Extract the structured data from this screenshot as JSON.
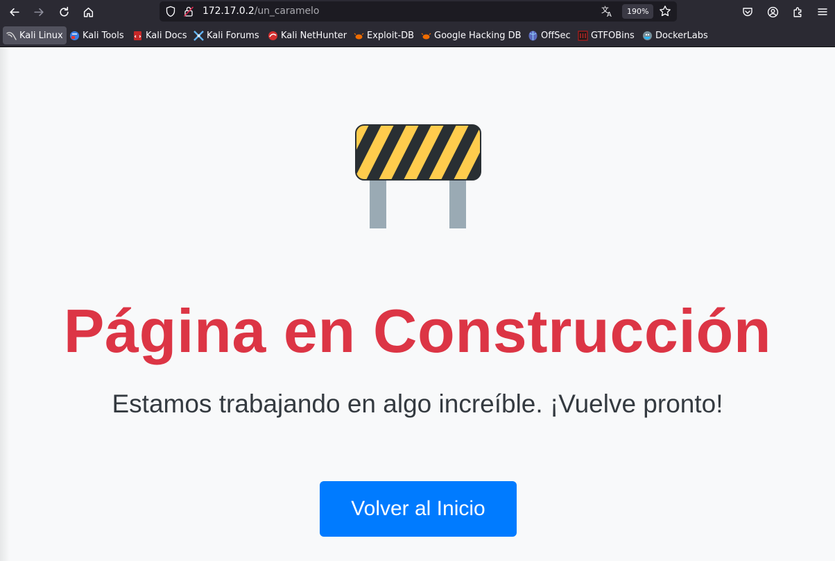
{
  "browser": {
    "url_host": "172.17.0.2",
    "url_path": "/un_caramelo",
    "zoom": "190%",
    "icons": {
      "back": "arrow-left-icon",
      "forward": "arrow-right-icon",
      "reload": "reload-icon",
      "home": "home-icon",
      "shield": "shield-icon",
      "lock": "lock-icon",
      "translate": "translate-icon",
      "bookmark_star": "star-icon",
      "pocket": "pocket-icon",
      "account": "account-icon",
      "extensions": "puzzle-icon",
      "menu": "hamburger-menu-icon"
    }
  },
  "bookmarks": [
    {
      "label": "Kali Linux"
    },
    {
      "label": "Kali Tools"
    },
    {
      "label": "Kali Docs"
    },
    {
      "label": "Kali Forums"
    },
    {
      "label": "Kali NetHunter"
    },
    {
      "label": "Exploit-DB"
    },
    {
      "label": "Google Hacking DB"
    },
    {
      "label": "OffSec"
    },
    {
      "label": "GTFOBins"
    },
    {
      "label": "DockerLabs"
    }
  ],
  "page": {
    "title": "Página en Construcción",
    "subtitle": "Estamos trabajando en algo increíble. ¡Vuelve pronto!",
    "button_label": "Volver al Inicio",
    "colors": {
      "title": "#dc3545",
      "button": "#007bff",
      "background": "#f8f9fa"
    },
    "illustration": "construction-barrier-icon"
  }
}
